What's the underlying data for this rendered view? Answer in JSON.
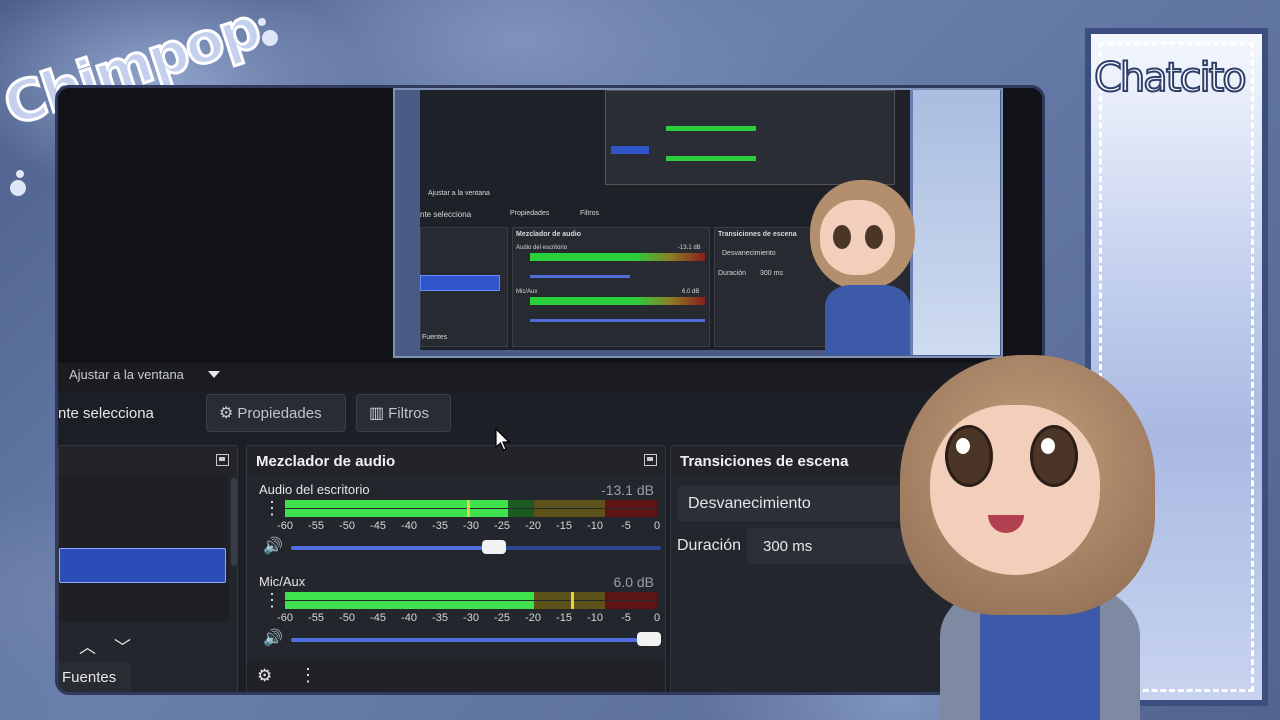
{
  "overlay": {
    "streamer_name": "Chimpop",
    "chat_panel_title": "Chatcito"
  },
  "obs": {
    "preview_toolbar": {
      "fit_label": "Ajustar a la ventana"
    },
    "source_toolbar": {
      "selection_label": "nte selecciona",
      "properties_label": "Propiedades",
      "filters_label": "Filtros"
    },
    "scenes_dock": {
      "tab_label": "Fuentes"
    },
    "audio_mixer": {
      "title": "Mezclador de audio",
      "scale": [
        "-60",
        "-55",
        "-50",
        "-45",
        "-40",
        "-35",
        "-30",
        "-25",
        "-20",
        "-15",
        "-10",
        "-5",
        "0"
      ],
      "channels": [
        {
          "name": "Audio del escritorio",
          "db": "-13.1 dB",
          "level": 0.6,
          "peak": 0.49,
          "volume": 0.58
        },
        {
          "name": "Mic/Aux",
          "db": "6.0 dB",
          "level": 0.67,
          "peak": 0.77,
          "volume": 1.0
        }
      ]
    },
    "transitions": {
      "title": "Transiciones de escena",
      "selected": "Desvanecimiento",
      "duration_label": "Duración",
      "duration_value": "300 ms"
    },
    "nested_preview": {
      "fit_label": "Ajustar a la ventana",
      "selection_label": "nte selecciona",
      "properties_label": "Propiedades",
      "filters_label": "Filtros",
      "mixer_title": "Mezclador de audio",
      "ch1_name": "Audio del escritorio",
      "ch1_db": "-13.1 dB",
      "ch2_name": "Mic/Aux",
      "ch2_db": "6.0 dB",
      "transitions_title": "Transiciones de escena",
      "transition": "Desvanecimiento",
      "duration_label": "Duración",
      "duration_value": "300 ms",
      "tab_label": "Fuentes"
    }
  },
  "colors": {
    "accent": "#2c4db8",
    "meter_green": "#3fe24d",
    "meter_yellow": "#e2d340",
    "meter_red": "#8c1c1c",
    "frame": "#3c4e80"
  }
}
